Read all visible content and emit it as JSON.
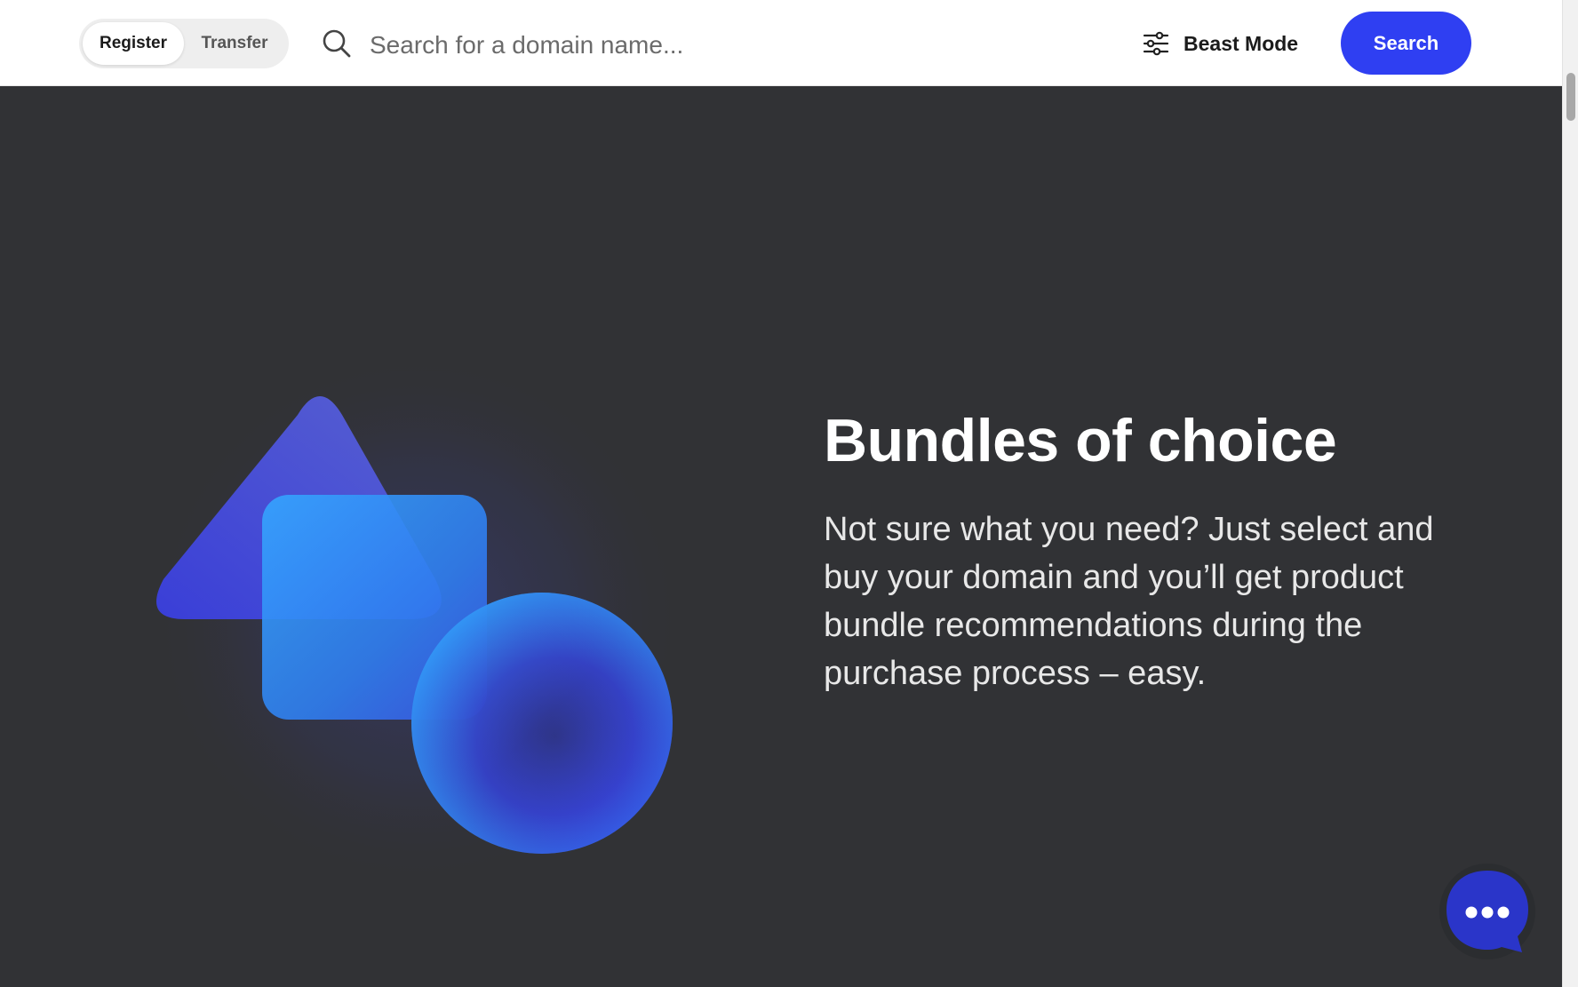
{
  "header": {
    "toggle": {
      "register_label": "Register",
      "transfer_label": "Transfer",
      "active": "Register"
    },
    "search": {
      "placeholder": "Search for a domain name...",
      "value": ""
    },
    "beast_mode_label": "Beast Mode",
    "search_button_label": "Search"
  },
  "hero": {
    "title": "Bundles of choice",
    "body": "Not sure what you need? Just select and buy your domain and you’ll get product bundle recommendations during the purchase process – easy."
  },
  "icons": {
    "search": "search-icon",
    "sliders": "sliders-icon",
    "chat": "chat-bubble-icon",
    "hero_illustration": "shapes-illustration"
  },
  "colors": {
    "accent": "#2f3ff2",
    "hero_bg": "#313235",
    "chat_bubble": "#2a35c9"
  }
}
